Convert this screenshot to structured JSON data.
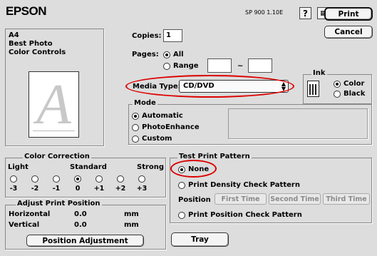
{
  "brand": "EPSON",
  "model": "SP 900 1.10E",
  "toolbar": {
    "help_label": "?",
    "print_label": "Print",
    "cancel_label": "Cancel"
  },
  "summary": {
    "paper": "A4",
    "quality": "Best Photo",
    "color": "Color Controls"
  },
  "preview_letter": "A",
  "copies": {
    "label": "Copies:",
    "value": "1"
  },
  "pages": {
    "label": "Pages:",
    "all_label": "All",
    "range_label": "Range",
    "tilde": "~",
    "selected": "All"
  },
  "media_type": {
    "label": "Media Type:",
    "value": "CD/DVD"
  },
  "ink": {
    "title": "Ink",
    "options": [
      "Color",
      "Black"
    ],
    "selected": "Color"
  },
  "mode": {
    "title": "Mode",
    "options": [
      "Automatic",
      "PhotoEnhance",
      "Custom"
    ],
    "selected": "Automatic"
  },
  "color_correction": {
    "title": "Color Correction",
    "light_label": "Light",
    "standard_label": "Standard",
    "strong_label": "Strong",
    "scale": [
      "-3",
      "-2",
      "-1",
      "0",
      "+1",
      "+2",
      "+3"
    ],
    "selected": "0"
  },
  "adjust_print_position": {
    "title": "Adjust Print Position",
    "rows": [
      {
        "label": "Horizontal",
        "value": "0.0",
        "unit": "mm"
      },
      {
        "label": "Vertical",
        "value": "0.0",
        "unit": "mm"
      }
    ],
    "button_label": "Position Adjustment"
  },
  "test_print": {
    "title": "Test Print Pattern",
    "none_label": "None",
    "density_label": "Print Density Check Pattern",
    "position_label": "Position",
    "buttons": [
      "First Time",
      "Second Time",
      "Third Time"
    ],
    "position_check_label": "Print Position Check Pattern",
    "selected": "None"
  },
  "tray_label": "Tray",
  "highlight_color": "#dd0000"
}
